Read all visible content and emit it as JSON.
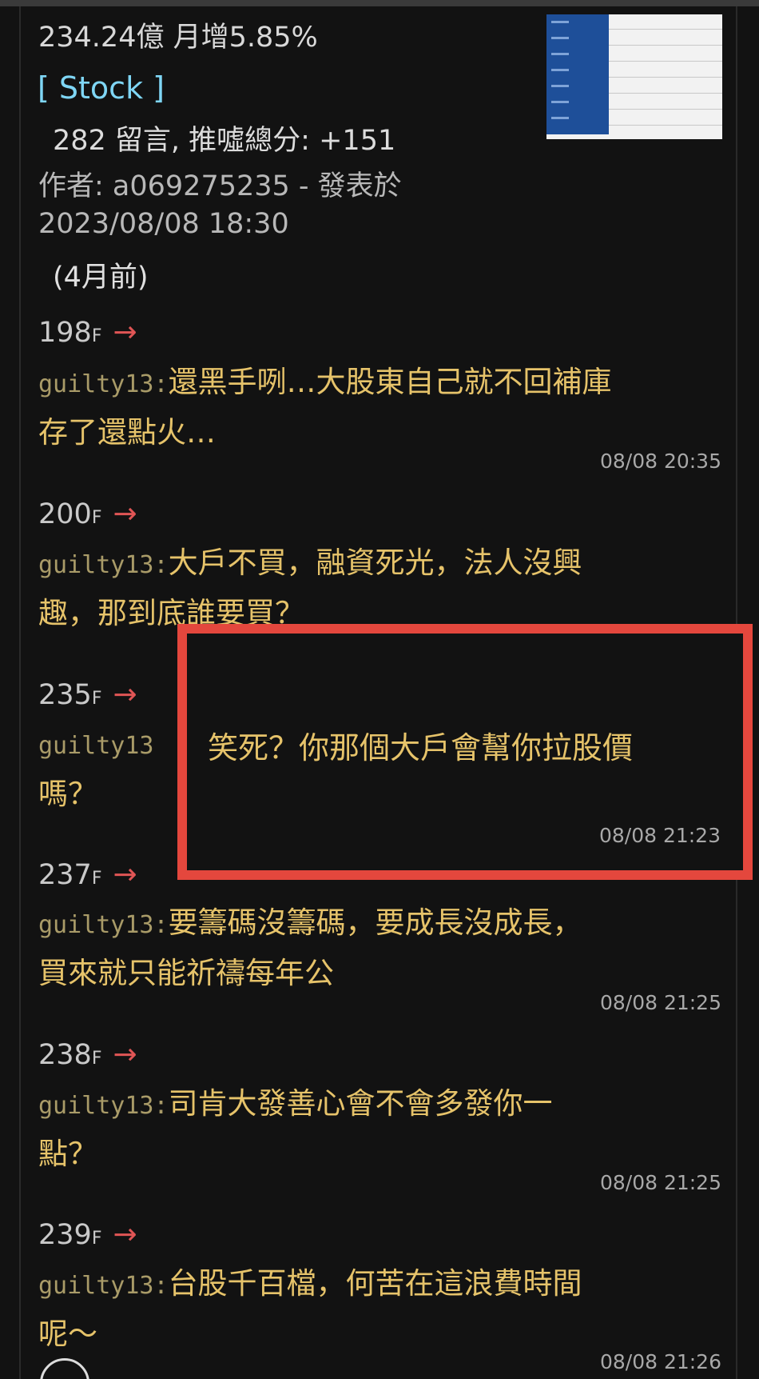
{
  "post": {
    "subtitle": "234.24億 月增5.85%",
    "board": "[ Stock ]",
    "comment_count_line": "282 留言, 推噓總分: +151",
    "author_line": "作者: a069275235 - 發表於",
    "date": "2023/08/08 18:30",
    "ago": "(4月前)"
  },
  "comments": [
    {
      "floor": "198",
      "floor_suffix": "F",
      "arrow": "→",
      "user": "guilty13:",
      "line1": "還黑手咧…大股東自己就不回補庫",
      "line2": "存了還點火…",
      "time": "08/08 20:35"
    },
    {
      "floor": "200",
      "floor_suffix": "F",
      "arrow": "→",
      "user": "guilty13:",
      "line1": "大戶不買，融資死光，法人沒興",
      "line2": "趣，那到底誰要買？",
      "time": ""
    },
    {
      "floor": "235",
      "floor_suffix": "F",
      "arrow": "→",
      "user": "guilty13",
      "line1": "",
      "line2": "嗎？",
      "time": ""
    },
    {
      "floor": "237",
      "floor_suffix": "F",
      "arrow": "→",
      "user": "guilty13:",
      "line1": "要籌碼沒籌碼，要成長沒成長，",
      "line2": "買來就只能祈禱每年公",
      "time": "08/08 21:25"
    },
    {
      "floor": "238",
      "floor_suffix": "F",
      "arrow": "→",
      "user": "guilty13:",
      "line1": "司肯大發善心會不會多發你一",
      "line2": "點？",
      "time": "08/08 21:25"
    },
    {
      "floor": "239",
      "floor_suffix": "F",
      "arrow": "→",
      "user": "guilty13:",
      "line1": "台股千百檔，何苦在這浪費時間",
      "line2": "呢～",
      "time": "08/08 21:26"
    }
  ],
  "highlight": {
    "text": "笑死？你那個大戶會幫你拉股價",
    "time": "08/08 21:23",
    "border_color": "#e4473d"
  },
  "colors": {
    "background": "#121212",
    "comment_text": "#e6c36a",
    "username": "#a99b68",
    "board_tag": "#7fd6f5",
    "arrow": "#e05555"
  },
  "icons": {
    "arrow": "right-arrow-icon",
    "fab": "circle-button-icon"
  }
}
